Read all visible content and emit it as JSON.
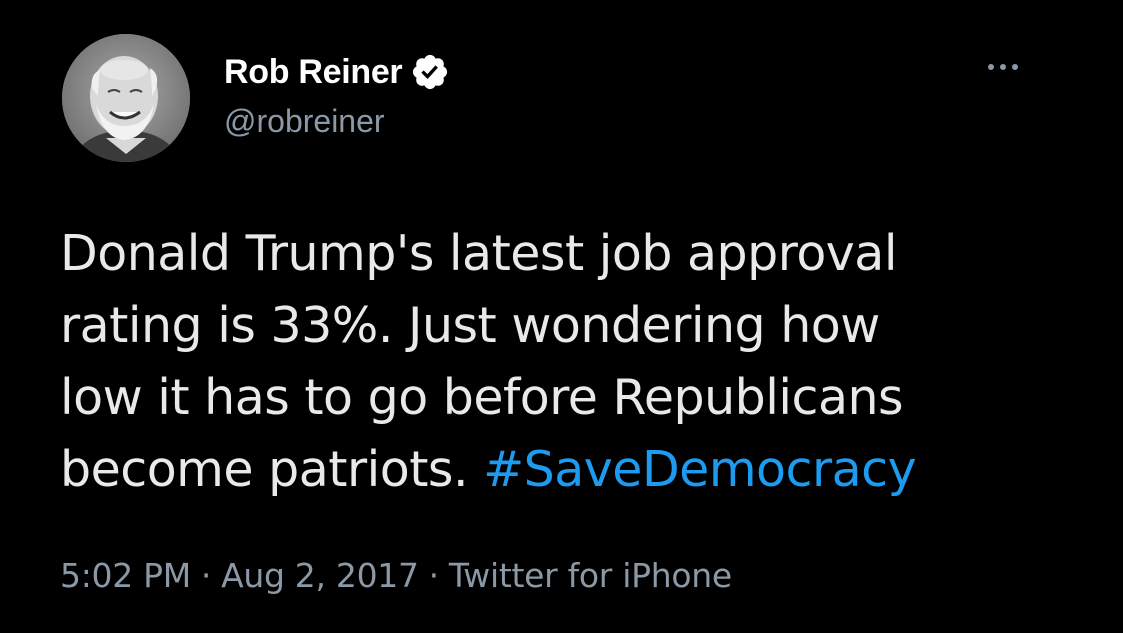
{
  "author": {
    "display_name": "Rob Reiner",
    "handle": "@robreiner",
    "verified": true,
    "verified_icon": "verified-badge-icon"
  },
  "tweet": {
    "text_line_1": "Donald Trump's latest job approval",
    "text_line_2": "rating is 33%. Just wondering how",
    "text_line_3": "low it has to go before Republicans",
    "text_line_4": "become patriots.",
    "hashtag": "#SaveDemocracy"
  },
  "meta": {
    "time": "5:02 PM",
    "separator": "·",
    "date": "Aug 2, 2017",
    "source": "Twitter for iPhone"
  },
  "icons": {
    "more": "more-horizontal-icon",
    "avatar": "profile-avatar"
  },
  "colors": {
    "background": "#000000",
    "text": "#e7e9ea",
    "secondary_text": "#8b98a5",
    "link": "#1d9bf0"
  }
}
